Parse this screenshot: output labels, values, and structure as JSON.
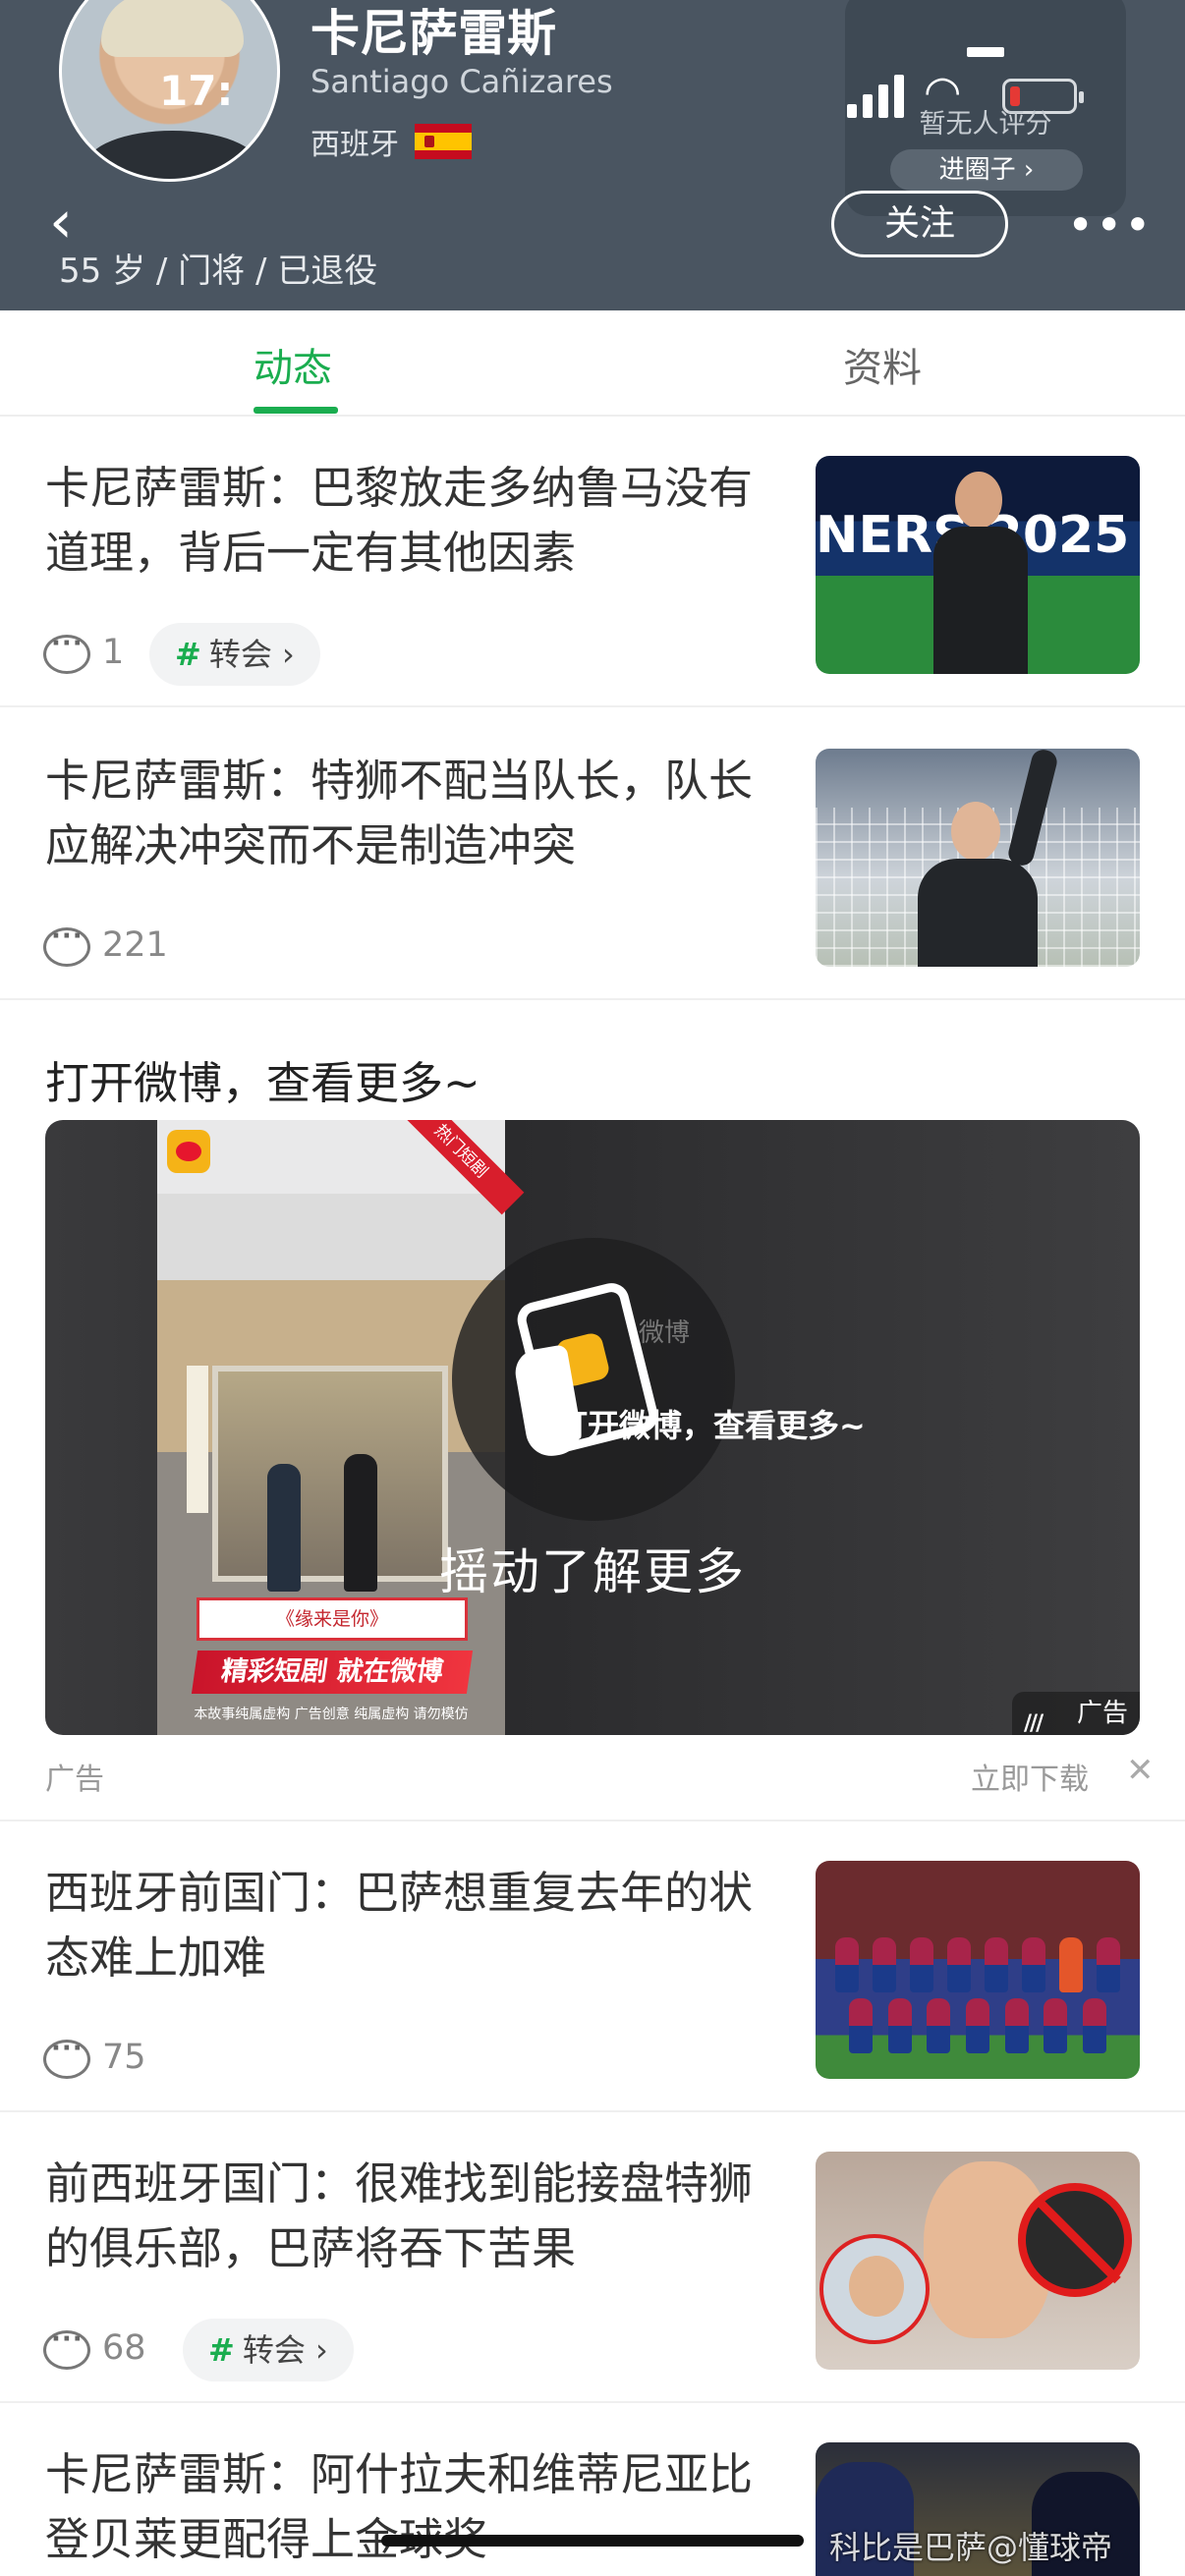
{
  "status_bar": {
    "time": "17:"
  },
  "header": {
    "name": "卡尼萨雷斯",
    "name_en": "Santiago Cañizares",
    "nation": "西班牙",
    "meta": "55 岁 / 门将 / 已退役",
    "back_icon": "chevron-left-icon",
    "follow_label": "关注",
    "more_label": "•••",
    "rating": {
      "text": "暂无人评分",
      "circle_label": "进圈子 ›"
    }
  },
  "tabs": [
    {
      "label": "动态",
      "active": true
    },
    {
      "label": "资料",
      "active": false
    }
  ],
  "news": [
    {
      "title": "卡尼萨雷斯：巴黎放走多纳鲁马没有道理，背后一定有其他因素",
      "comments": "1",
      "tag": "转会 ›",
      "thumb_text": "NERS 2025"
    },
    {
      "title": "卡尼萨雷斯：特狮不配当队长，队长应解决冲突而不是制造冲突",
      "comments": "221"
    },
    {
      "title": "西班牙前国门：巴萨想重复去年的状态难上加难",
      "comments": "75"
    },
    {
      "title": "前西班牙国门：很难找到能接盘特狮的俱乐部，巴萨将吞下苦果",
      "comments": "68",
      "tag": "转会 ›"
    },
    {
      "title": "卡尼萨雷斯：阿什拉夫和维蒂尼亚比登贝莱更配得上金球奖"
    }
  ],
  "ad": {
    "headline": "打开微博，查看更多~",
    "poster_corner": "热门短剧",
    "poster_quote": "《缘来是你》",
    "poster_banner": "精彩短剧 就在微博",
    "poster_fine": "本故事纯属虚构 广告创意 纯属虚构 请勿模仿",
    "overlay_brand": "微博",
    "overlay_cta": "打开微博，查看更多~",
    "shake_text": "摇动了解更多",
    "badge": "广告",
    "label": "广告",
    "download": "立即下载",
    "close": "✕"
  },
  "watermark": "科比是巴萨@懂球帝",
  "colors": {
    "header_bg": "#4a5561",
    "accent": "#1aad4f"
  }
}
